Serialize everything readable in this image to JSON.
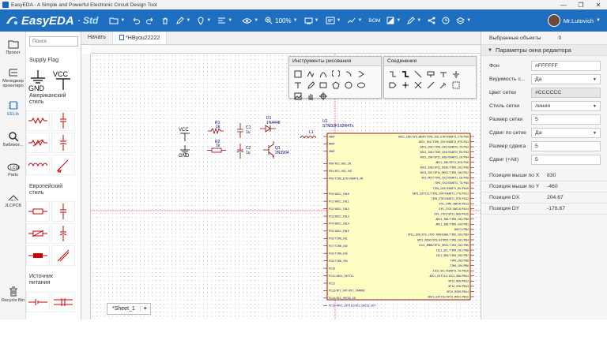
{
  "window": {
    "title": "EasyEDA - A Simple and Powerful Electronic Circuit Design Tool",
    "minimize": "—",
    "maximize": "❐",
    "close": "✕"
  },
  "toolbar": {
    "logo": "EasyEDA",
    "edition": "· Std",
    "zoom": "100%",
    "bom": "BOM",
    "user": "Mr.Lutovich"
  },
  "leftnav": [
    {
      "label": "Проект"
    },
    {
      "label": "Менеджер проектиро"
    },
    {
      "label": "EELib"
    },
    {
      "label": "Библиот..."
    },
    {
      "label": "Parts"
    },
    {
      "label": "JLCPCB"
    },
    {
      "label": "Recycle Bin"
    }
  ],
  "library": {
    "search_placeholder": "Поиск",
    "sections": [
      "Supply Flag",
      "Американский стиль",
      "Европейский стиль",
      "Источник питания"
    ],
    "gnd": "GND",
    "vcc": "VCC"
  },
  "tabs": [
    {
      "label": "Начать"
    },
    {
      "label": "*НВyou22222"
    }
  ],
  "drawing_tools": {
    "title": "Инструменты рисования"
  },
  "wiring_tools": {
    "title": "Соединения"
  },
  "sheet": {
    "name": "*Sheet_1",
    "add": "+"
  },
  "schematic": {
    "vcc": "VCC",
    "gnd": "GND",
    "r1": "R1",
    "r1_val": "1k",
    "r2": "R2",
    "r2_val": "1k",
    "c1": "C1",
    "c1_val": "1u",
    "c2": "C2",
    "c2_val": "1u",
    "d1": "D1",
    "d1_val": "1N4448",
    "q1": "Q1",
    "q1_val": "2N3904",
    "l1": "L1",
    "u1": "U1",
    "u1_val": "STM32F102R4Tx",
    "pins_left": [
      "VBAT",
      "NRST",
      "VBAT",
      "PD0/RCC_OSC_IN",
      "PD1/RCC_OSC_OUT",
      "PD2/TIM3_ETR/USART5_RX",
      "PC0/ADC1_IN10",
      "PC1/ADC1_IN11",
      "PC2/ADC1_IN12",
      "PC3/ADC1_IN13",
      "PC4/ADC1_IN14",
      "PC5/ADC1_IN15",
      "PC6/TIM8_CH1",
      "PC7/TIM8_CH2",
      "PC8/TIM8_CH3",
      "PC9/TIM8_CH4",
      "PC10",
      "PC11/ADC1_EXTI11",
      "PC12",
      "PC13/RTC_OUT/RTC_TAMPER",
      "PC14/RCC_OSC32_IN",
      "PC15/ADC1_EXTI15/RCC_OSC32_OUT"
    ],
    "pins_right": [
      "ADC1_IN0/SYS_WKUP/TIM2_CH1_ETR/USART2_CTS/PA0",
      "ADC1_IN1/TIM2_CH2/USART2_RTS/PA1",
      "ADC1_IN2/TIM2_CH3/USART2_TX/PA2",
      "ADC1_IN3/TIM2_CH4/USART2_RX/PA3",
      "ADC1_IN4/SPI1_NSS/USART2_CK/PA4",
      "ADC1_IN5/SPI1_SCK/PA5",
      "ADC1_IN6/SPI1_MISO/TIM3_CH1/PA6",
      "ADC1_IN7/SPI1_MOSI/TIM3_CH2/PA7",
      "RCC_MCO/TIM1_CH1/USART1_CK/PA8",
      "TIM1_CH2/USART1_TX/PA9",
      "TIM1_CH3/USART1_RX/PA10",
      "ADC1_EXTI11/TIM1_CH4/USART1_CTS/PA11",
      "TIM1_ETR/USART1_RTS/PA12",
      "SYS_JTMS-SWDIO/PA13",
      "SYS_JTCK-SWCLK/PA14",
      "SYS_JTDI/SPI1_NSS/PA15",
      "ADC1_IN8/TIM3_CH3/PB0",
      "ADC1_IN9/TIM3_CH4/PB1",
      "BOOT1/PB2",
      "SPI1_SCK/SYS_JTDO-TRACESWO/TIM2_CH2/PB3",
      "SPI1_MISO/SYS_NJTRST/TIM3_CH1/PB4",
      "I2C1_SMBA/SPI1_MOSI/TIM3_CH2/PB5",
      "I2C1_SCL/TIM4_CH1/PB6",
      "I2C1_SDA/TIM4_CH2/PB7",
      "TIM4_CH3/PB8",
      "TIM4_CH4/PB9",
      "I2C2_SCL/USART3_TX/PB10",
      "ADC1_EXTI11/I2C2_SDA/PB11",
      "SPI2_NSS/PB12",
      "SPI2_SCK/PB13",
      "SPI2_MISO/PB14",
      "ADC1_EXTI15/SPI2_MOSI/PB15"
    ]
  },
  "right_panel": {
    "selected_label": "Выбранные объекты",
    "selected_count": "0",
    "section_title": "Параметры окна редактора",
    "props": [
      {
        "label": "Фон",
        "value": "#FFFFFF",
        "dropdown": false,
        "gray": false
      },
      {
        "label": "Видимость с...",
        "value": "Да",
        "dropdown": true,
        "gray": false
      },
      {
        "label": "Цвет сетки",
        "value": "#CCCCCC",
        "dropdown": false,
        "gray": true
      },
      {
        "label": "Стиль сетки",
        "value": "линия",
        "dropdown": true,
        "gray": false
      },
      {
        "label": "Размер сетки",
        "value": "5",
        "dropdown": false,
        "gray": false
      },
      {
        "label": "Сдвиг по сетке",
        "value": "Да",
        "dropdown": true,
        "gray": false
      },
      {
        "label": "Размер сдвига",
        "value": "5",
        "dropdown": false,
        "gray": false
      },
      {
        "label": "Сдвиг (+Alt)",
        "value": "5",
        "dropdown": false,
        "gray": false
      }
    ],
    "mouse": [
      {
        "label": "Позиция мыши по X",
        "value": "830"
      },
      {
        "label": "Позиция мыши по Y",
        "value": "-460"
      },
      {
        "label": "Позиция DX",
        "value": "204.67"
      },
      {
        "label": "Позиция DY",
        "value": "-176.67"
      }
    ]
  },
  "colors": {
    "toolbar": "#1e6fc0",
    "ic_fill": "#ffffc4",
    "ic_border": "#8b0000",
    "wire": "#00008b",
    "crosshair": "#ff5555"
  }
}
